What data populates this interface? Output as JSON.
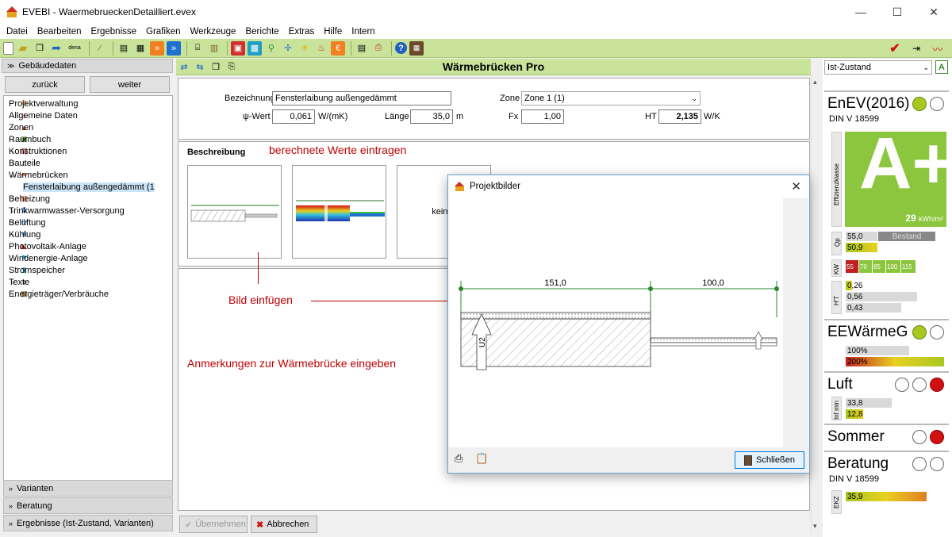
{
  "window": {
    "title": "EVEBI - WaermebrueckenDetailliert.evex",
    "minimize": "—",
    "maximize": "☐",
    "close": "✕"
  },
  "menu": [
    "Datei",
    "Bearbeiten",
    "Ergebnisse",
    "Grafiken",
    "Werkzeuge",
    "Berichte",
    "Extras",
    "Hilfe",
    "Intern"
  ],
  "toolbar_icons": [
    "new-file-icon",
    "open-folder-icon",
    "copy-icon",
    "export-icon",
    "dena-icon",
    "magic-wand-icon",
    "document-icon",
    "plan-icon",
    "arrow-right-icon",
    "chevron-icon",
    "building-icon",
    "table-icon",
    "image-red-icon",
    "grid-icon",
    "magnify-icon",
    "fan-icon",
    "sun-icon",
    "fire-icon",
    "euro-icon",
    "report-icon",
    "print-icon",
    "help-icon",
    "calculator-icon"
  ],
  "toolbar_right_icons": [
    "check-icon",
    "transfer-icon",
    "chart-icon"
  ],
  "left": {
    "header": "Gebäudedaten",
    "back_label": "zurück",
    "next_label": "weiter",
    "tree": [
      {
        "label": "Projektverwaltung",
        "exp": "",
        "indent": 0,
        "icon": "gear-icon"
      },
      {
        "label": "Allgemeine Daten",
        "exp": "",
        "indent": 0,
        "icon": "house-icon"
      },
      {
        "label": "Zonen",
        "exp": ">",
        "indent": 0,
        "icon": "zone-icon"
      },
      {
        "label": "Raumbuch",
        "exp": ">",
        "indent": 0,
        "icon": "room-icon"
      },
      {
        "label": "Konstruktionen",
        "exp": ">",
        "indent": 0,
        "icon": "construction-icon"
      },
      {
        "label": "Bauteile",
        "exp": ">",
        "indent": 0,
        "icon": "component-icon"
      },
      {
        "label": "Wärmebrücken",
        "exp": "v",
        "indent": 0,
        "icon": "thermal-bridge-icon"
      },
      {
        "label": "Fensterlaibung außengedämmt (1",
        "exp": "",
        "indent": 1,
        "icon": "thermal-bridge-icon",
        "selected": true
      },
      {
        "label": "Beheizung",
        "exp": ">",
        "indent": 0,
        "icon": "heating-icon"
      },
      {
        "label": "Trinkwarmwasser-Versorgung",
        "exp": ">",
        "indent": 0,
        "icon": "water-icon"
      },
      {
        "label": "Belüftung",
        "exp": ">",
        "indent": 0,
        "icon": "ventilation-icon"
      },
      {
        "label": "Kühlung",
        "exp": ">",
        "indent": 0,
        "icon": "cooling-icon"
      },
      {
        "label": "Photovoltaik-Anlage",
        "exp": "",
        "indent": 0,
        "icon": "pv-icon"
      },
      {
        "label": "Windenergie-Anlage",
        "exp": "",
        "indent": 0,
        "icon": "wind-icon"
      },
      {
        "label": "Stromspeicher",
        "exp": "",
        "indent": 0,
        "icon": "battery-icon"
      },
      {
        "label": "Texte",
        "exp": ">",
        "indent": 0,
        "icon": "text-icon"
      },
      {
        "label": "Energieträger/Verbräuche",
        "exp": ">",
        "indent": 0,
        "icon": "energy-icon"
      }
    ],
    "sections": [
      "Varianten",
      "Beratung",
      "Ergebnisse (Ist-Zustand, Varianten)"
    ]
  },
  "main": {
    "title": "Wärmebrücken Pro",
    "bezeichnung_label": "Bezeichnung",
    "bezeichnung_value": "Fensterlaibung außengedämmt",
    "psi_label": "ψ-Wert",
    "psi_value": "0,061",
    "psi_unit": "W/(mK)",
    "laenge_label": "Länge",
    "laenge_value": "35,0",
    "laenge_unit": "m",
    "zone_label": "Zone",
    "zone_value": "Zone 1 (1)",
    "fx_label": "Fx",
    "fx_value": "1,00",
    "ht_label": "HT",
    "ht_value": "2,135",
    "ht_unit": "W/K",
    "beschreibung_label": "Beschreibung",
    "kein_bild": "kein B",
    "annot_berechnete": "berechnete Werte eintragen",
    "annot_bild": "Bild einfügen",
    "annot_anmerkungen": "Anmerkungen zur Wärmebrücke eingeben",
    "btn_uebernehmen": "Übernehmen",
    "btn_abbrechen": "Abbrechen"
  },
  "dialog": {
    "title": "Projektbilder",
    "close_btn": "Schließen",
    "dim_left": "151,0",
    "dim_right": "100,0",
    "u_label": "U2"
  },
  "right": {
    "state": "Ist-Zustand",
    "a_btn": "A",
    "enev_title": "EnEV(2016)",
    "enev_sub": "DIN V 18599",
    "eff_label": "Effizienzklasse",
    "grade": "A+",
    "grade_value": "29",
    "grade_unit": "kWh/m²",
    "qp_label": "Qp",
    "qp_val1": "55,0",
    "qp_bestand": "Bestand",
    "qp_val2": "50,9",
    "kw_label": "KW",
    "kw_vals": [
      "55",
      "70",
      "85",
      "100",
      "115"
    ],
    "ht_label": "H'T",
    "ht_vals": [
      "0,26",
      "0,56",
      "0,43"
    ],
    "ee_title": "EEWärmeG",
    "ee_vals": [
      "100%",
      "200%"
    ],
    "luft_title": "Luft",
    "luft_label": "Inf min",
    "luft_vals": [
      "33,8",
      "12,8"
    ],
    "sommer_title": "Sommer",
    "beratung_title": "Beratung",
    "beratung_sub": "DIN V 18599",
    "ekz_label": "EKZ",
    "ekz_val": "35,9"
  }
}
